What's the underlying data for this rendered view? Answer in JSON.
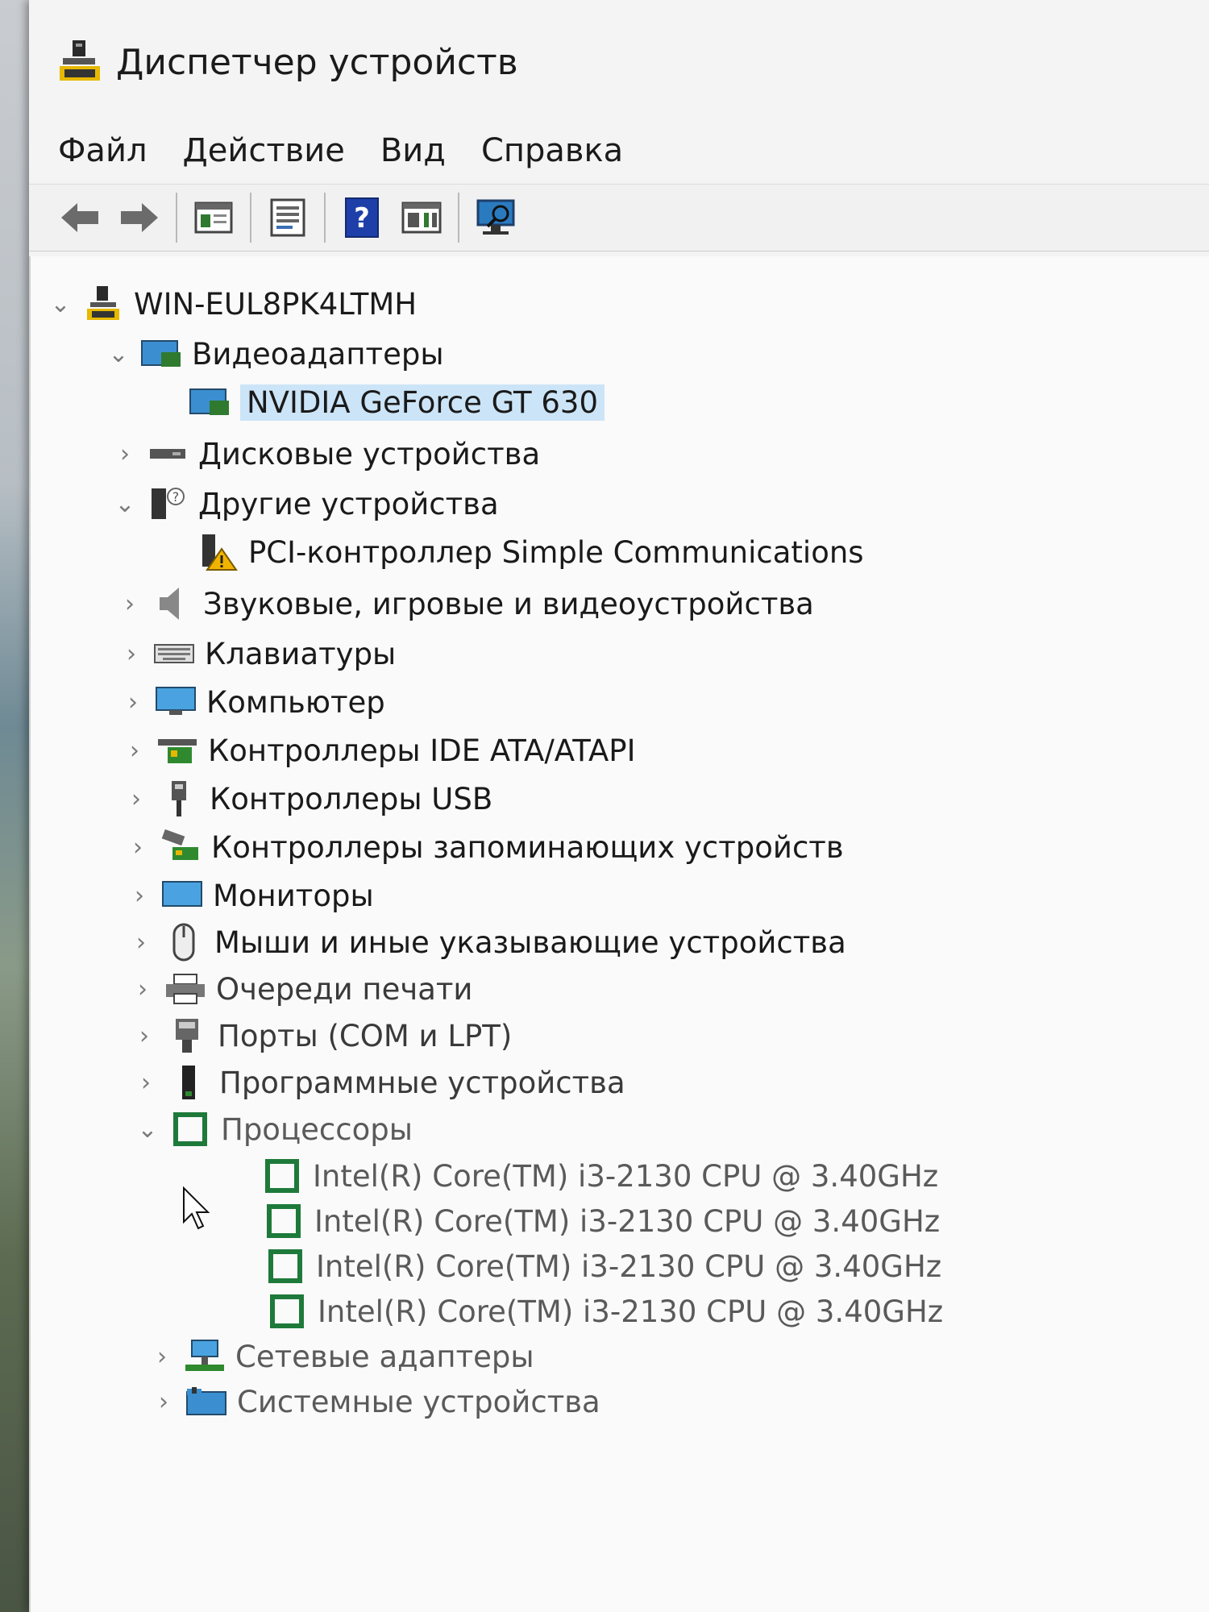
{
  "window": {
    "title": "Диспетчер устройств"
  },
  "menu": [
    "Файл",
    "Действие",
    "Вид",
    "Справка"
  ],
  "toolbar_icons": [
    "back-arrow-icon",
    "forward-arrow-icon",
    "properties-panel-icon",
    "device-list-icon",
    "help-icon",
    "action-pane-icon",
    "monitor-scan-icon"
  ],
  "tree": {
    "root": "WIN-EUL8PK4LTMH",
    "items": [
      {
        "label": "Видеоадаптеры",
        "expanded": true,
        "children": [
          "NVIDIA GeForce GT 630"
        ]
      },
      {
        "label": "Дисковые устройства",
        "expanded": false
      },
      {
        "label": "Другие устройства",
        "expanded": true,
        "children": [
          "PCI-контроллер Simple Communications"
        ]
      },
      {
        "label": "Звуковые, игровые и видеоустройства",
        "expanded": false
      },
      {
        "label": "Клавиатуры",
        "expanded": false
      },
      {
        "label": "Компьютер",
        "expanded": false
      },
      {
        "label": "Контроллеры IDE ATA/ATAPI",
        "expanded": false
      },
      {
        "label": "Контроллеры USB",
        "expanded": false
      },
      {
        "label": "Контроллеры запоминающих устройств",
        "expanded": false
      },
      {
        "label": "Мониторы",
        "expanded": false
      },
      {
        "label": "Мыши и иные указывающие устройства",
        "expanded": false
      },
      {
        "label": "Очереди печати",
        "expanded": false
      },
      {
        "label": "Порты (COM и LPT)",
        "expanded": false
      },
      {
        "label": "Программные устройства",
        "expanded": false
      },
      {
        "label": "Процессоры",
        "expanded": true,
        "children": [
          "Intel(R) Core(TM) i3-2130 CPU @ 3.40GHz",
          "Intel(R) Core(TM) i3-2130 CPU @ 3.40GHz",
          "Intel(R) Core(TM) i3-2130 CPU @ 3.40GHz",
          "Intel(R) Core(TM) i3-2130 CPU @ 3.40GHz"
        ]
      },
      {
        "label": "Сетевые адаптеры",
        "expanded": false
      },
      {
        "label": "Системные устройства",
        "expanded": false
      }
    ]
  },
  "colors": {
    "selection": "#cce4f7",
    "cpu_green": "#1e7a3a",
    "help_blue": "#1e3fa8"
  }
}
